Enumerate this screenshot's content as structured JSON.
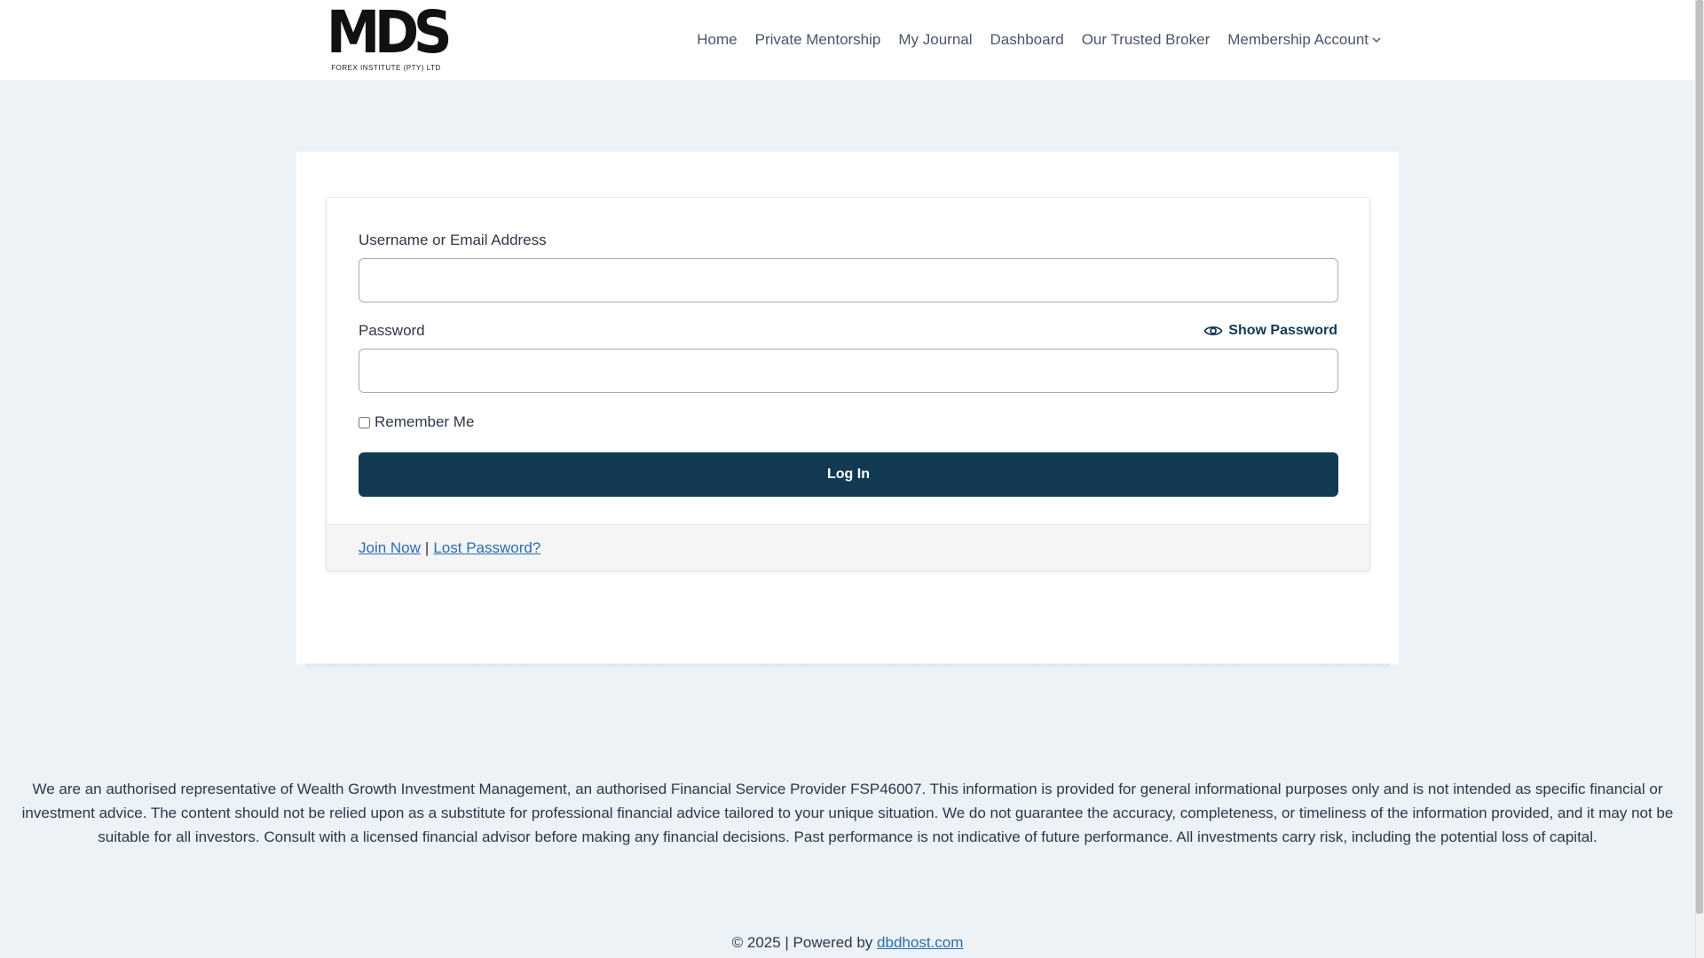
{
  "header": {
    "logo": {
      "mark": "MDS",
      "subtitle": "FOREX INSTITUTE (PTY) LTD"
    },
    "nav": [
      {
        "label": "Home"
      },
      {
        "label": "Private Mentorship"
      },
      {
        "label": "My Journal"
      },
      {
        "label": "Dashboard"
      },
      {
        "label": "Our Trusted Broker"
      },
      {
        "label": "Membership Account",
        "icon": "chevron-down-icon"
      }
    ]
  },
  "login": {
    "username_label": "Username or Email Address",
    "username_value": "",
    "password_label": "Password",
    "password_value": "",
    "show_password_label": "Show Password",
    "show_password_icon": "eye-icon",
    "remember_label": "Remember Me",
    "remember_checked": false,
    "submit_label": "Log In",
    "join_label": "Join Now",
    "separator": "|",
    "lost_password_label": "Lost Password?"
  },
  "footer": {
    "disclaimer": "We are an authorised representative of Wealth Growth Investment Management, an authorised Financial Service Provider FSP46007. This information is provided for general informational purposes only and is not intended as specific financial or investment advice. The content should not be relied upon as a substitute for professional financial advice tailored to your unique situation. We do not guarantee the accuracy, completeness, or timeliness of the information provided, and it may not be suitable for all investors. Consult with a licensed financial advisor before making any financial decisions. Past performance is not indicative of future performance. All investments carry risk, including the potential loss of capital.",
    "copyright_prefix": "© 2025 | Powered by",
    "host_link": "dbdhost.com"
  },
  "colors": {
    "primary": "#123a52",
    "link": "#2b6cb0",
    "page_bg": "#edf2f7"
  }
}
